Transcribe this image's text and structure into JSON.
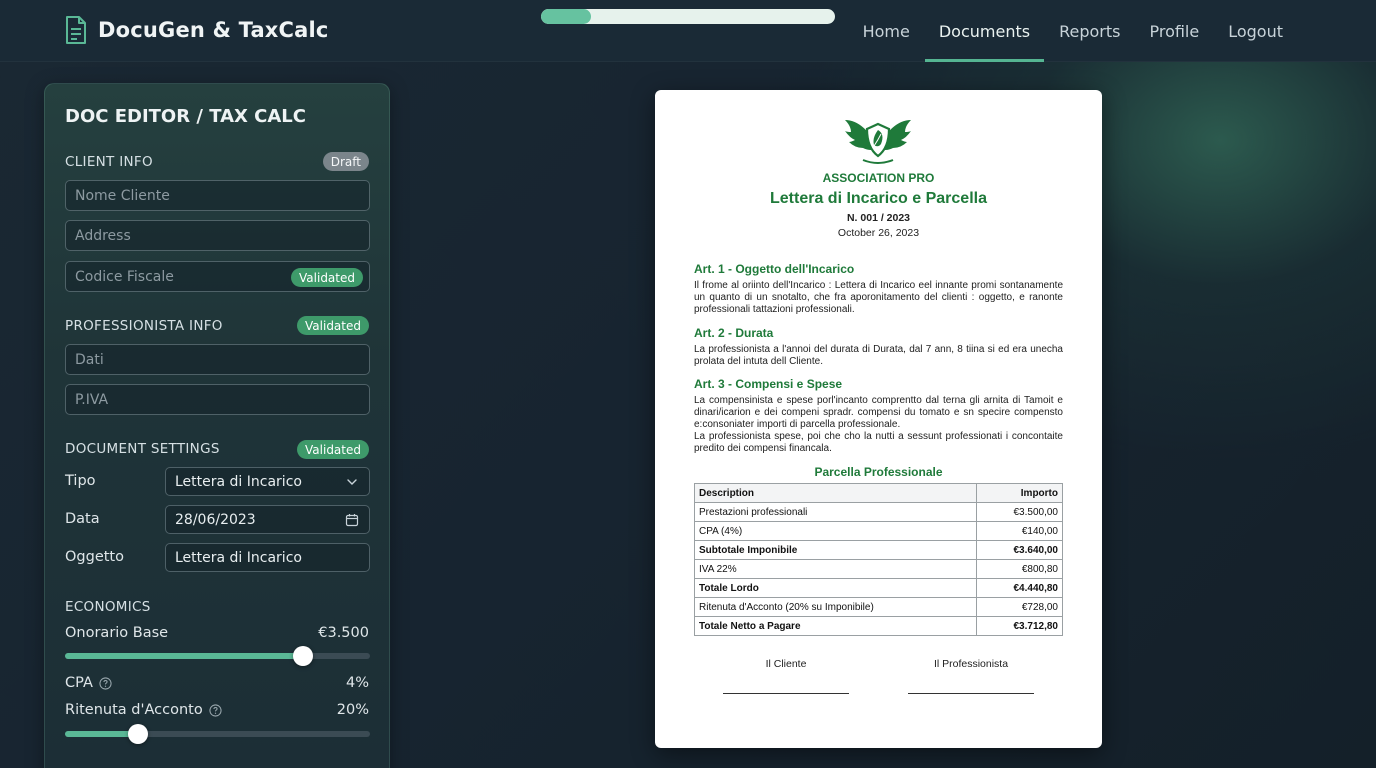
{
  "app": {
    "name": "DocuGen & TaxCalc",
    "progress_percent": 17
  },
  "nav": {
    "items": [
      {
        "label": "Home",
        "active": false
      },
      {
        "label": "Documents",
        "active": true
      },
      {
        "label": "Reports",
        "active": false
      },
      {
        "label": "Profile",
        "active": false
      },
      {
        "label": "Logout",
        "active": false
      }
    ]
  },
  "panel": {
    "title": "DOC EDITOR / TAX CALC",
    "client": {
      "label": "CLIENT INFO",
      "badge": "Draft",
      "name_placeholder": "Nome Cliente",
      "address_placeholder": "Address",
      "cf_placeholder": "Codice Fiscale",
      "cf_badge": "Validated"
    },
    "professionista": {
      "label": "PROFESSIONISTA INFO",
      "badge": "Validated",
      "dati_placeholder": "Dati",
      "piva_placeholder": "P.IVA"
    },
    "settings": {
      "label": "DOCUMENT SETTINGS",
      "badge": "Validated",
      "tipo_label": "Tipo",
      "tipo_value": "Lettera di Incarico",
      "data_label": "Data",
      "data_value": "28/06/2023",
      "oggetto_label": "Oggetto",
      "oggetto_value": "Lettera di Incarico"
    },
    "economics": {
      "label": "ECONOMICS",
      "onorario_label": "Onorario Base",
      "onorario_value": "€3.500",
      "onorario_fraction": 0.78,
      "cpa_label": "CPA",
      "cpa_value": "4%",
      "ritenuta_label": "Ritenuta d'Acconto",
      "ritenuta_value": "20%",
      "ritenuta_fraction": 0.24
    }
  },
  "doc": {
    "association": "ASSOCIATION PRO",
    "title": "Lettera di Incarico e Parcella",
    "number": "N. 001 / 2023",
    "date": "October 26, 2023",
    "articles": [
      {
        "title": "Art. 1 - Oggetto dell'Incarico",
        "text": "Il frome al oriinto dell'Incarico : Lettera di Incarico eel innante promi sontanamente un quanto di un snotalto, che fra aporonitamento del clienti : oggetto, e ranonte professionali tattazioni professionali."
      },
      {
        "title": "Art. 2 - Durata",
        "text": "La professionista a l'annoi del durata di Durata, dal 7 ann, 8 tiina si ed era unecha prolata del intuta dell Cliente."
      },
      {
        "title": "Art. 3 - Compensi e Spese",
        "text": "La compensinista e spese porl'incanto comprentto dal terna gli arnita di Tamoit e dinari/icarion e dei compeni spradr. compensi du tomato e sn specire compensto e:consoniater importi di parcella professionale.\nLa professionista spese, poi che cho la nutti a sessunt professionati i concontaite predito dei compensi financala."
      }
    ],
    "parcella_title": "Parcella Professionale",
    "table": {
      "headers": [
        "Description",
        "Importo"
      ],
      "rows": [
        {
          "desc": "Prestazioni professionali",
          "amount": "€3.500,00",
          "bold": false
        },
        {
          "desc": "CPA (4%)",
          "amount": "€140,00",
          "bold": false
        },
        {
          "desc": "Subtotale Imponibile",
          "amount": "€3.640,00",
          "bold": true
        },
        {
          "desc": "IVA 22%",
          "amount": "€800,80",
          "bold": false
        },
        {
          "desc": "Totale Lordo",
          "amount": "€4.440,80",
          "bold": true
        },
        {
          "desc": "Ritenuta d'Acconto (20% su Imponibile)",
          "amount": "€728,00",
          "bold": false
        },
        {
          "desc": "Totale Netto a Pagare",
          "amount": "€3.712,80",
          "bold": true
        }
      ]
    },
    "signatures": {
      "client": "Il Cliente",
      "professional": "Il Professionista"
    }
  },
  "colors": {
    "accent": "#55b592",
    "doc_green": "#1f7a3a",
    "badge_green": "#3e9a6a",
    "badge_grey": "#7b858b"
  }
}
